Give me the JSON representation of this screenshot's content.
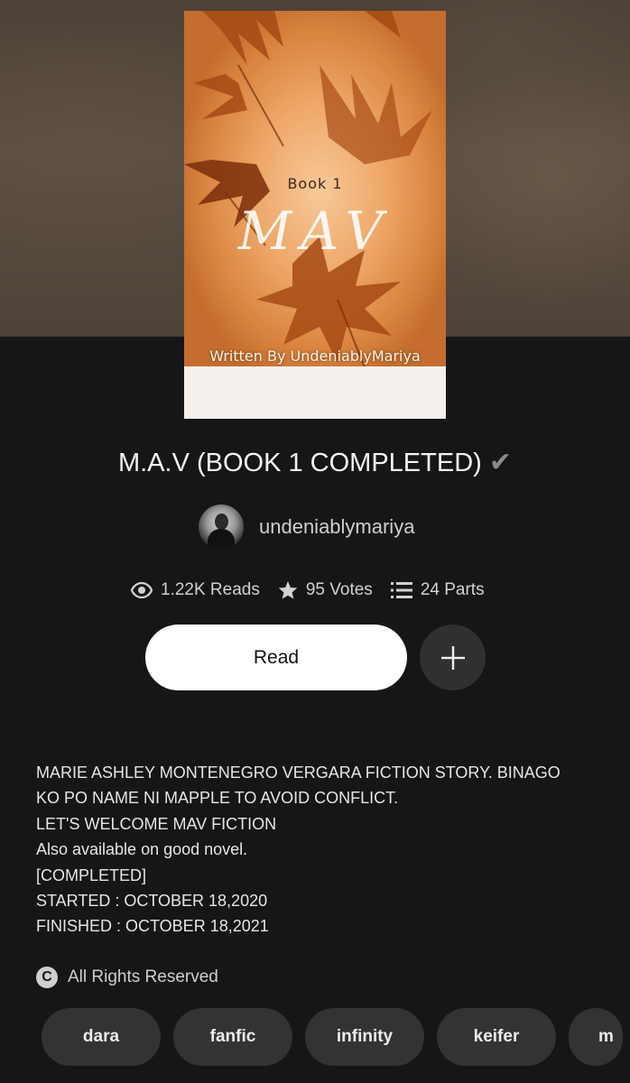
{
  "cover": {
    "book_label": "Book 1",
    "title_art": "MAV",
    "author_credit": "Written By UndeniablyMariya"
  },
  "story": {
    "title": "M.A.V (BOOK 1 COMPLETED)",
    "title_mark": "✔"
  },
  "author": {
    "name": "undeniablymariya"
  },
  "stats": {
    "reads": "1.22K Reads",
    "votes": "95 Votes",
    "parts": "24 Parts"
  },
  "actions": {
    "read_label": "Read",
    "add_label": "+"
  },
  "description": {
    "lines": [
      "MARIE ASHLEY MONTENEGRO VERGARA FICTION STORY. BINAGO",
      "KO PO NAME NI MAPPLE TO AVOID CONFLICT.",
      "LET'S WELCOME MAV FICTION",
      "Also available on good novel.",
      "[COMPLETED]",
      "STARTED : OCTOBER 18,2020",
      "FINISHED : OCTOBER 18,2021"
    ]
  },
  "copyright": {
    "icon_symbol": "C",
    "label": "All Rights Reserved"
  },
  "tags": [
    "dara",
    "fanfic",
    "infinity",
    "keifer",
    "m"
  ]
}
